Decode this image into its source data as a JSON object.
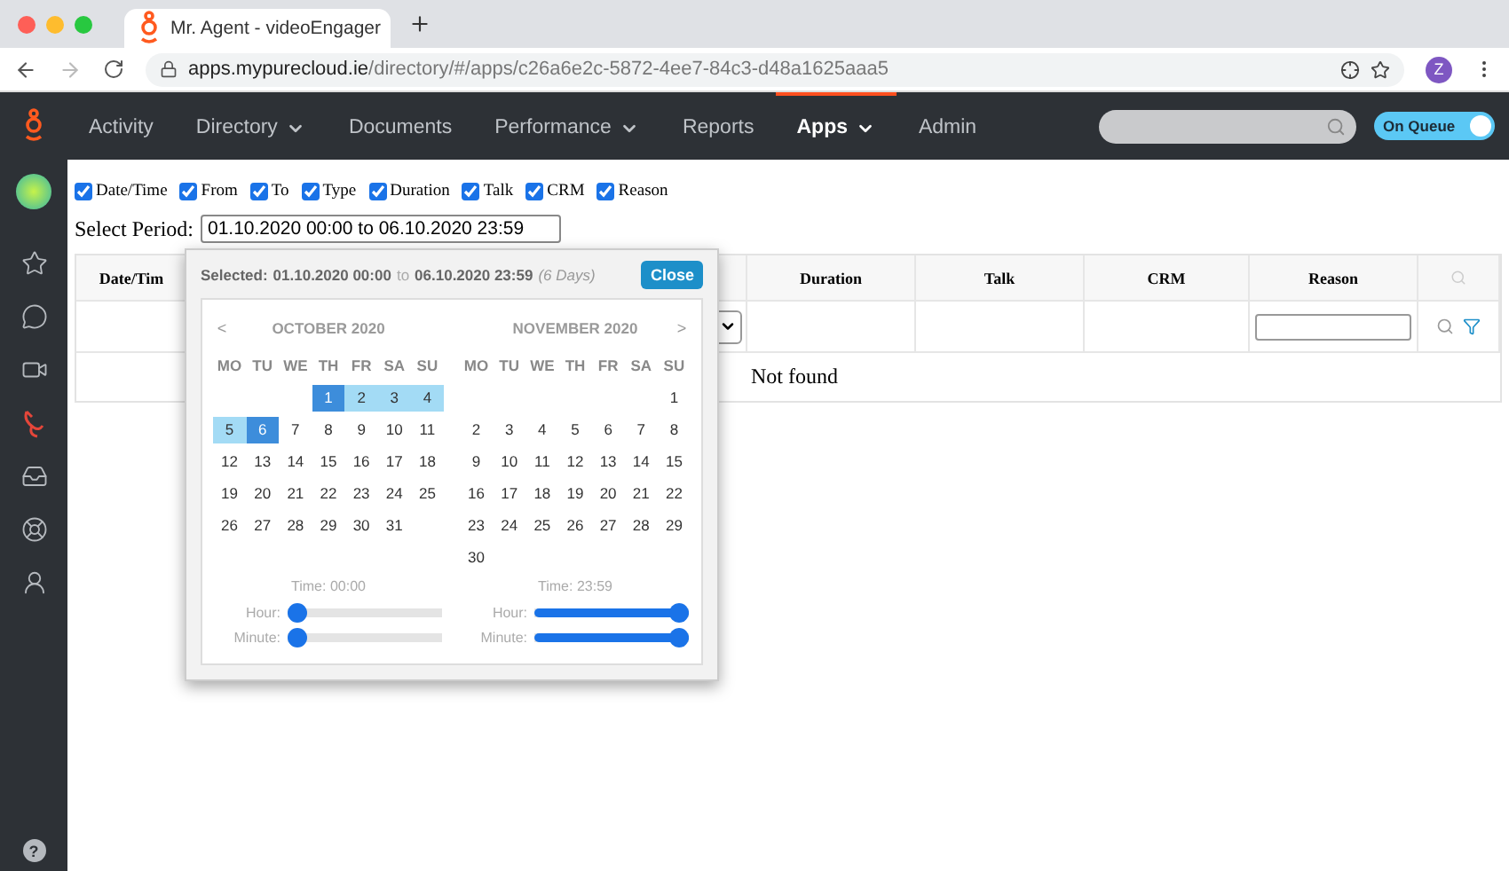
{
  "browser": {
    "tab_title": "Mr. Agent - videoEngager",
    "url_domain": "apps.mypurecloud.ie",
    "url_path": "/directory/#/apps/c26a6e2c-5872-4ee7-84c3-d48a1625aaa5",
    "profile": "Z"
  },
  "nav": {
    "items": [
      {
        "label": "Activity",
        "has_menu": false,
        "selected": false
      },
      {
        "label": "Directory",
        "has_menu": true,
        "selected": false
      },
      {
        "label": "Documents",
        "has_menu": false,
        "selected": false
      },
      {
        "label": "Performance",
        "has_menu": true,
        "selected": false
      },
      {
        "label": "Reports",
        "has_menu": false,
        "selected": false
      },
      {
        "label": "Apps",
        "has_menu": true,
        "selected": true
      },
      {
        "label": "Admin",
        "has_menu": false,
        "selected": false
      }
    ],
    "queue": {
      "label": "On Queue",
      "on": true
    }
  },
  "sidebar": {
    "items": [
      {
        "kind": "star",
        "selected": false
      },
      {
        "kind": "chat",
        "selected": false
      },
      {
        "kind": "video",
        "selected": false
      },
      {
        "kind": "phone",
        "selected": true
      },
      {
        "kind": "inbox",
        "selected": false
      },
      {
        "kind": "lifebuoy",
        "selected": false
      },
      {
        "kind": "person",
        "selected": false
      }
    ]
  },
  "help": "?",
  "columns_toggle": [
    {
      "label": "Date/Time",
      "checked": true
    },
    {
      "label": "From",
      "checked": true
    },
    {
      "label": "To",
      "checked": true
    },
    {
      "label": "Type",
      "checked": true
    },
    {
      "label": "Duration",
      "checked": true
    },
    {
      "label": "Talk",
      "checked": true
    },
    {
      "label": "CRM",
      "checked": true
    },
    {
      "label": "Reason",
      "checked": true
    }
  ],
  "period": {
    "label": "Select Period:",
    "value": "01.10.2020 00:00 to 06.10.2020 23:59"
  },
  "table": {
    "columns": [
      "Date/Tim",
      "Duration",
      "Talk",
      "CRM",
      "Reason"
    ],
    "empty_message": "Not found"
  },
  "picker": {
    "selected_label": "Selected:",
    "start": "01.10.2020 00:00",
    "separator": "to",
    "end": "06.10.2020 23:59",
    "duration": "(6 Days)",
    "close": "Close",
    "prev": "<",
    "next": ">",
    "months": [
      {
        "title": "OCTOBER 2020",
        "weekdays": [
          "MO",
          "TU",
          "WE",
          "TH",
          "FR",
          "SA",
          "SU"
        ],
        "time": "Time: 00:00",
        "hour_label": "Hour:",
        "minute_label": "Minute:",
        "hour": {
          "level": 0
        },
        "minute": {
          "level": 0
        },
        "weeks": [
          [
            {
              "kind": "blank"
            },
            {
              "kind": "blank"
            },
            {
              "kind": "blank"
            },
            {
              "kind": "day",
              "t": "1",
              "selected": true,
              "in_range": true
            },
            {
              "kind": "day",
              "t": "2",
              "selected": false,
              "in_range": true
            },
            {
              "kind": "day",
              "t": "3",
              "selected": false,
              "in_range": true
            },
            {
              "kind": "day",
              "t": "4",
              "selected": false,
              "in_range": true
            }
          ],
          [
            {
              "kind": "day",
              "t": "5",
              "selected": false,
              "in_range": true
            },
            {
              "kind": "day",
              "t": "6",
              "selected": true,
              "in_range": true
            },
            {
              "kind": "day",
              "t": "7",
              "selected": false,
              "in_range": false
            },
            {
              "kind": "day",
              "t": "8",
              "selected": false,
              "in_range": false
            },
            {
              "kind": "day",
              "t": "9",
              "selected": false,
              "in_range": false
            },
            {
              "kind": "day",
              "t": "10",
              "selected": false,
              "in_range": false
            },
            {
              "kind": "day",
              "t": "11",
              "selected": false,
              "in_range": false
            }
          ],
          [
            {
              "kind": "day",
              "t": "12",
              "selected": false,
              "in_range": false
            },
            {
              "kind": "day",
              "t": "13",
              "selected": false,
              "in_range": false
            },
            {
              "kind": "day",
              "t": "14",
              "selected": false,
              "in_range": false
            },
            {
              "kind": "day",
              "t": "15",
              "selected": false,
              "in_range": false
            },
            {
              "kind": "day",
              "t": "16",
              "selected": false,
              "in_range": false
            },
            {
              "kind": "day",
              "t": "17",
              "selected": false,
              "in_range": false
            },
            {
              "kind": "day",
              "t": "18",
              "selected": false,
              "in_range": false
            }
          ],
          [
            {
              "kind": "day",
              "t": "19",
              "selected": false,
              "in_range": false
            },
            {
              "kind": "day",
              "t": "20",
              "selected": false,
              "in_range": false
            },
            {
              "kind": "day",
              "t": "21",
              "selected": false,
              "in_range": false
            },
            {
              "kind": "day",
              "t": "22",
              "selected": false,
              "in_range": false
            },
            {
              "kind": "day",
              "t": "23",
              "selected": false,
              "in_range": false
            },
            {
              "kind": "day",
              "t": "24",
              "selected": false,
              "in_range": false
            },
            {
              "kind": "day",
              "t": "25",
              "selected": false,
              "in_range": false
            }
          ],
          [
            {
              "kind": "day",
              "t": "26",
              "selected": false,
              "in_range": false
            },
            {
              "kind": "day",
              "t": "27",
              "selected": false,
              "in_range": false
            },
            {
              "kind": "day",
              "t": "28",
              "selected": false,
              "in_range": false
            },
            {
              "kind": "day",
              "t": "29",
              "selected": false,
              "in_range": false
            },
            {
              "kind": "day",
              "t": "30",
              "selected": false,
              "in_range": false
            },
            {
              "kind": "day",
              "t": "31",
              "selected": false,
              "in_range": false
            },
            {
              "kind": "blank"
            }
          ]
        ]
      },
      {
        "title": "NOVEMBER 2020",
        "weekdays": [
          "MO",
          "TU",
          "WE",
          "TH",
          "FR",
          "SA",
          "SU"
        ],
        "time": "Time: 23:59",
        "hour_label": "Hour:",
        "minute_label": "Minute:",
        "hour": {
          "level": 1
        },
        "minute": {
          "level": 1
        },
        "weeks": [
          [
            {
              "kind": "blank"
            },
            {
              "kind": "blank"
            },
            {
              "kind": "blank"
            },
            {
              "kind": "blank"
            },
            {
              "kind": "blank"
            },
            {
              "kind": "blank"
            },
            {
              "kind": "day",
              "t": "1",
              "selected": false,
              "in_range": false
            }
          ],
          [
            {
              "kind": "day",
              "t": "2",
              "selected": false,
              "in_range": false
            },
            {
              "kind": "day",
              "t": "3",
              "selected": false,
              "in_range": false
            },
            {
              "kind": "day",
              "t": "4",
              "selected": false,
              "in_range": false
            },
            {
              "kind": "day",
              "t": "5",
              "selected": false,
              "in_range": false
            },
            {
              "kind": "day",
              "t": "6",
              "selected": false,
              "in_range": false
            },
            {
              "kind": "day",
              "t": "7",
              "selected": false,
              "in_range": false
            },
            {
              "kind": "day",
              "t": "8",
              "selected": false,
              "in_range": false
            }
          ],
          [
            {
              "kind": "day",
              "t": "9",
              "selected": false,
              "in_range": false
            },
            {
              "kind": "day",
              "t": "10",
              "selected": false,
              "in_range": false
            },
            {
              "kind": "day",
              "t": "11",
              "selected": false,
              "in_range": false
            },
            {
              "kind": "day",
              "t": "12",
              "selected": false,
              "in_range": false
            },
            {
              "kind": "day",
              "t": "13",
              "selected": false,
              "in_range": false
            },
            {
              "kind": "day",
              "t": "14",
              "selected": false,
              "in_range": false
            },
            {
              "kind": "day",
              "t": "15",
              "selected": false,
              "in_range": false
            }
          ],
          [
            {
              "kind": "day",
              "t": "16",
              "selected": false,
              "in_range": false
            },
            {
              "kind": "day",
              "t": "17",
              "selected": false,
              "in_range": false
            },
            {
              "kind": "day",
              "t": "18",
              "selected": false,
              "in_range": false
            },
            {
              "kind": "day",
              "t": "19",
              "selected": false,
              "in_range": false
            },
            {
              "kind": "day",
              "t": "20",
              "selected": false,
              "in_range": false
            },
            {
              "kind": "day",
              "t": "21",
              "selected": false,
              "in_range": false
            },
            {
              "kind": "day",
              "t": "22",
              "selected": false,
              "in_range": false
            }
          ],
          [
            {
              "kind": "day",
              "t": "23",
              "selected": false,
              "in_range": false
            },
            {
              "kind": "day",
              "t": "24",
              "selected": false,
              "in_range": false
            },
            {
              "kind": "day",
              "t": "25",
              "selected": false,
              "in_range": false
            },
            {
              "kind": "day",
              "t": "26",
              "selected": false,
              "in_range": false
            },
            {
              "kind": "day",
              "t": "27",
              "selected": false,
              "in_range": false
            },
            {
              "kind": "day",
              "t": "28",
              "selected": false,
              "in_range": false
            },
            {
              "kind": "day",
              "t": "29",
              "selected": false,
              "in_range": false
            }
          ],
          [
            {
              "kind": "day",
              "t": "30",
              "selected": false,
              "in_range": false
            },
            {
              "kind": "blank"
            },
            {
              "kind": "blank"
            },
            {
              "kind": "blank"
            },
            {
              "kind": "blank"
            },
            {
              "kind": "blank"
            },
            {
              "kind": "blank"
            }
          ]
        ]
      }
    ]
  }
}
